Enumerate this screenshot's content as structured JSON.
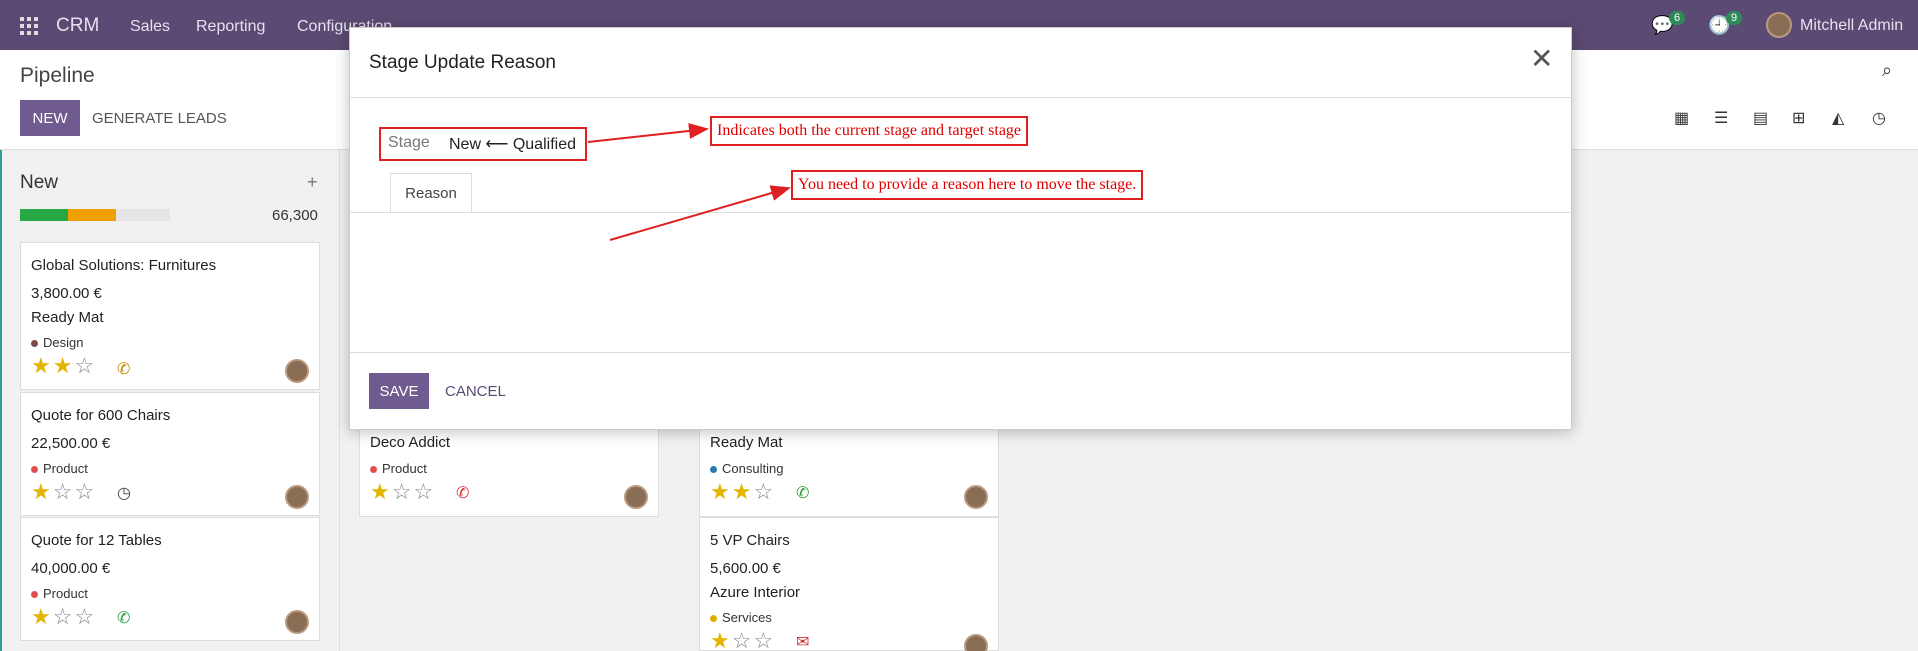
{
  "topbar": {
    "app_name": "CRM",
    "menu": [
      "Sales",
      "Reporting",
      "Configuration"
    ],
    "messages_count": "6",
    "activities_count": "9",
    "user_name": "Mitchell Admin"
  },
  "subheader": {
    "title": "Pipeline",
    "new_label": "NEW",
    "generate_label": "GENERATE LEADS"
  },
  "column_new": {
    "title": "New",
    "total": "66,300",
    "progress": [
      {
        "color": "#28a745",
        "fraction": 0.27
      },
      {
        "color": "#f0a000",
        "fraction": 0.27
      },
      {
        "color": "#e5e5e5",
        "fraction": 0.46
      }
    ]
  },
  "cards": [
    {
      "title": "Global Solutions: Furnitures",
      "amount": "3,800.00 €",
      "customer": "Ready Mat",
      "tag": "Design",
      "tag_color": "#7a4b4b",
      "stars": 2,
      "activity": "phone-icon"
    },
    {
      "title": "Quote for 600 Chairs",
      "amount": "22,500.00 €",
      "customer": "",
      "tag": "Product",
      "tag_color": "#e05050",
      "stars": 1,
      "activity": "clock-icon"
    },
    {
      "title": "Quote for 12 Tables",
      "amount": "40,000.00 €",
      "customer": "",
      "tag": "Product",
      "tag_color": "#e05050",
      "stars": 1,
      "activity": "phone-icon"
    },
    {
      "title": "Deco Addict",
      "tag": "Product",
      "tag_color": "#e05050",
      "stars": 1,
      "activity": "phone-icon"
    },
    {
      "title": "Ready Mat",
      "tag": "Consulting",
      "tag_color": "#2a7ab0",
      "stars": 2,
      "activity": "phone-icon"
    },
    {
      "title": "5 VP Chairs",
      "amount": "5,600.00 €",
      "customer": "Azure Interior",
      "tag": "Services",
      "tag_color": "#e0b000",
      "stars": 1,
      "activity": "mail-icon"
    }
  ],
  "modal": {
    "title": "Stage Update Reason",
    "stage_label": "Stage",
    "stage_value": "New ⟵ Qualified",
    "tab_label": "Reason",
    "save_label": "SAVE",
    "cancel_label": "CANCEL"
  },
  "annotations": {
    "stage_note": "Indicates both the current stage and target stage",
    "reason_note": "You need to provide a reason here to move the stage."
  }
}
